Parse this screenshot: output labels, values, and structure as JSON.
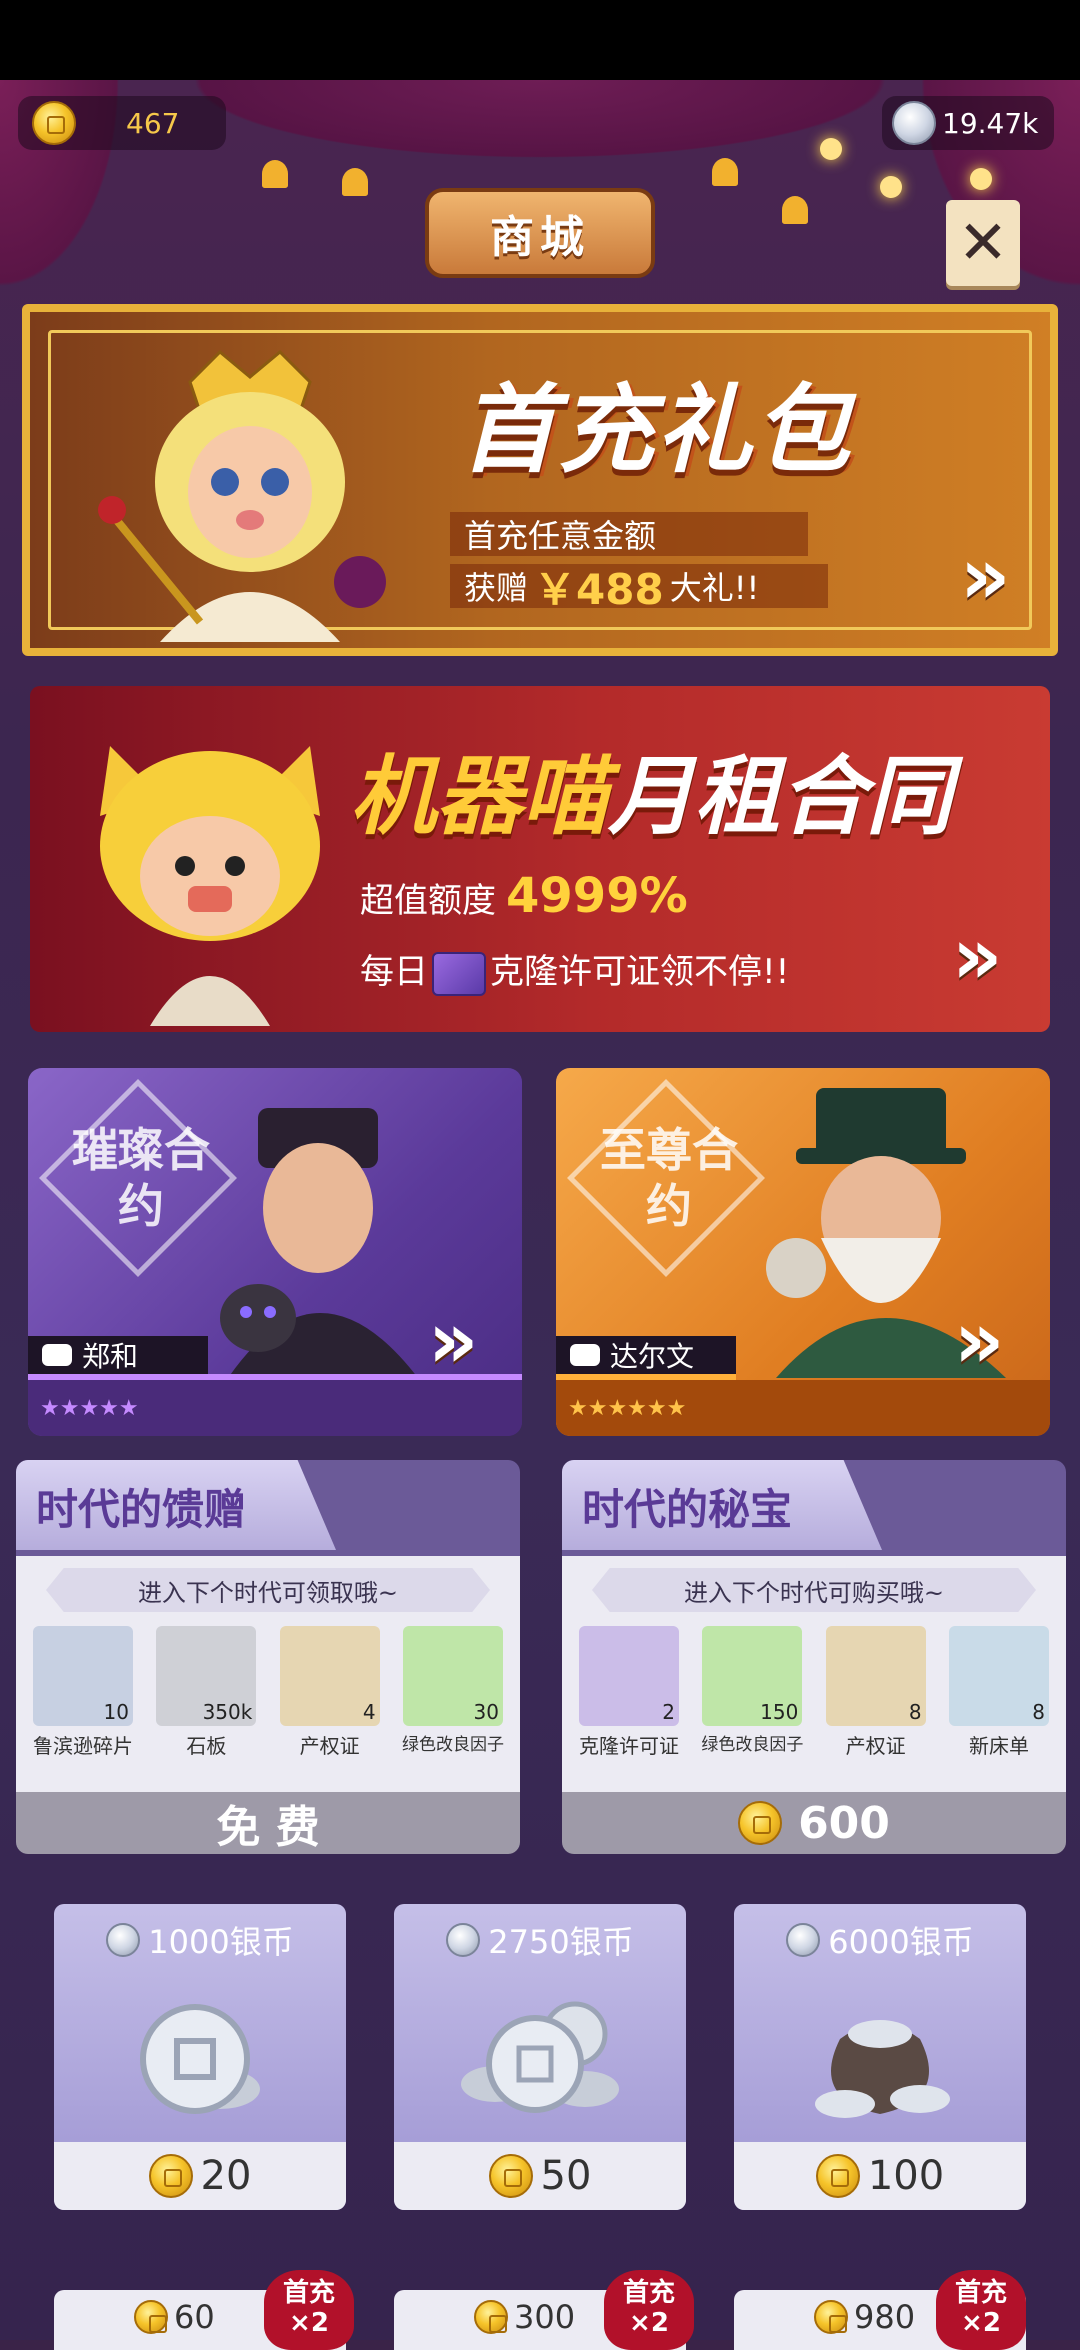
{
  "currency": {
    "gold": "467",
    "silver": "19.47k"
  },
  "title": "商城",
  "close_symbol": "✕",
  "banner_first_charge": {
    "title": "首充礼包",
    "line1": "首充任意金额",
    "line2_prefix": "获赠",
    "line2_amount": "￥488",
    "line2_suffix": "大礼!!",
    "arrow": "»"
  },
  "banner_monthly": {
    "title_yellow": "机器喵",
    "title_white": "月租合同",
    "line1_prefix": "超值额度",
    "line1_value": "4999%",
    "line2_prefix": "每日",
    "line2_suffix": "克隆许可证领不停!!",
    "arrow": "»"
  },
  "contracts": [
    {
      "badge": "璀璨合约",
      "name": "郑和",
      "stars": "★★★★★",
      "arrow": "»"
    },
    {
      "badge": "至尊合约",
      "name": "达尔文",
      "stars": "★★★★★★",
      "arrow": "»"
    }
  ],
  "gifts": [
    {
      "title": "时代的馈赠",
      "subtitle": "进入下个时代可领取哦~",
      "items": [
        {
          "name": "鲁滨逊碎片",
          "count": "10"
        },
        {
          "name": "石板",
          "count": "350k"
        },
        {
          "name": "产权证",
          "count": "4"
        },
        {
          "name": "绿色改良因子",
          "count": "30"
        }
      ],
      "price": "免 费"
    },
    {
      "title": "时代的秘宝",
      "subtitle": "进入下个时代可购买哦~",
      "items": [
        {
          "name": "克隆许可证",
          "count": "2"
        },
        {
          "name": "绿色改良因子",
          "count": "150"
        },
        {
          "name": "产权证",
          "count": "8"
        },
        {
          "name": "新床单",
          "count": "8"
        }
      ],
      "price": "600"
    }
  ],
  "silver_packs": [
    {
      "label": "1000银币",
      "price": "20"
    },
    {
      "label": "2750银币",
      "price": "50"
    },
    {
      "label": "6000银币",
      "price": "100"
    }
  ],
  "gold_packs": [
    {
      "value": "60",
      "badge": "首充×2"
    },
    {
      "value": "300",
      "badge": "首充×2"
    },
    {
      "value": "980",
      "badge": "首充×2"
    }
  ]
}
